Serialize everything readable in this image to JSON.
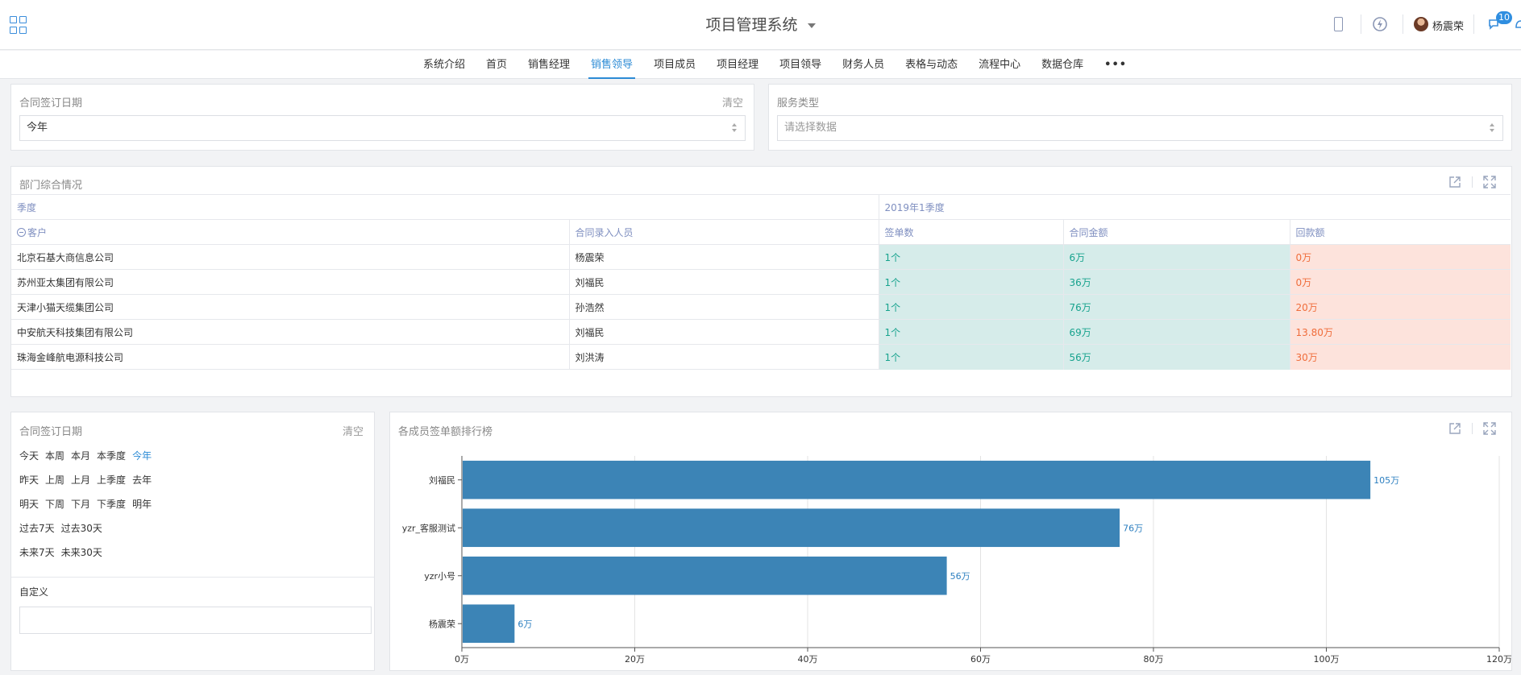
{
  "header": {
    "app_title": "项目管理系统",
    "user_name": "杨震荣",
    "notification_count": "10"
  },
  "nav": {
    "items": [
      "系统介绍",
      "首页",
      "销售经理",
      "销售领导",
      "项目成员",
      "项目经理",
      "项目领导",
      "财务人员",
      "表格与动态",
      "流程中心",
      "数据仓库"
    ],
    "active": "销售领导",
    "more": "•••"
  },
  "filter_date": {
    "label": "合同签订日期",
    "clear": "清空",
    "value": "今年"
  },
  "filter_service": {
    "label": "服务类型",
    "placeholder": "请选择数据"
  },
  "dept_panel": {
    "title": "部门综合情况",
    "season_label": "季度",
    "season_value": "2019年1季度",
    "columns": [
      "客户",
      "合同录入人员",
      "签单数",
      "合同金额",
      "回款额"
    ],
    "rows": [
      [
        "北京石基大商信息公司",
        "杨震荣",
        "1个",
        "6万",
        "0万"
      ],
      [
        "苏州亚太集团有限公司",
        "刘福民",
        "1个",
        "36万",
        "0万"
      ],
      [
        "天津小猫天缆集团公司",
        "孙浩然",
        "1个",
        "76万",
        "20万"
      ],
      [
        "中安航天科技集团有限公司",
        "刘福民",
        "1个",
        "69万",
        "13.80万"
      ],
      [
        "珠海金峰航电源科技公司",
        "刘洪涛",
        "1个",
        "56万",
        "30万"
      ]
    ]
  },
  "date_filter_panel": {
    "title": "合同签订日期",
    "clear": "清空",
    "rows": [
      [
        "今天",
        "本周",
        "本月",
        "本季度",
        "今年"
      ],
      [
        "昨天",
        "上周",
        "上月",
        "上季度",
        "去年"
      ],
      [
        "明天",
        "下周",
        "下月",
        "下季度",
        "明年"
      ],
      [
        "过去7天",
        "过去30天"
      ],
      [
        "未来7天",
        "未来30天"
      ]
    ],
    "active": "今年",
    "custom_label": "自定义"
  },
  "ranking_panel": {
    "title": "各成员签单额排行榜"
  },
  "chart_data": {
    "type": "bar",
    "orientation": "horizontal",
    "categories": [
      "刘福民",
      "yzr_客服测试",
      "yzr小号",
      "杨震荣"
    ],
    "values": [
      105,
      76,
      56,
      6
    ],
    "value_labels": [
      "105万",
      "76万",
      "56万",
      "6万"
    ],
    "x_ticks": [
      "0万",
      "20万",
      "40万",
      "60万",
      "80万",
      "100万",
      "120万"
    ],
    "xlim": [
      0,
      120
    ],
    "grid": true,
    "bar_color": "#3c84b6",
    "label_color": "#2c7fc0"
  },
  "colors": {
    "accent": "#2c8bd5",
    "green_cell": "#d6ecea",
    "red_cell": "#fde3dc"
  }
}
